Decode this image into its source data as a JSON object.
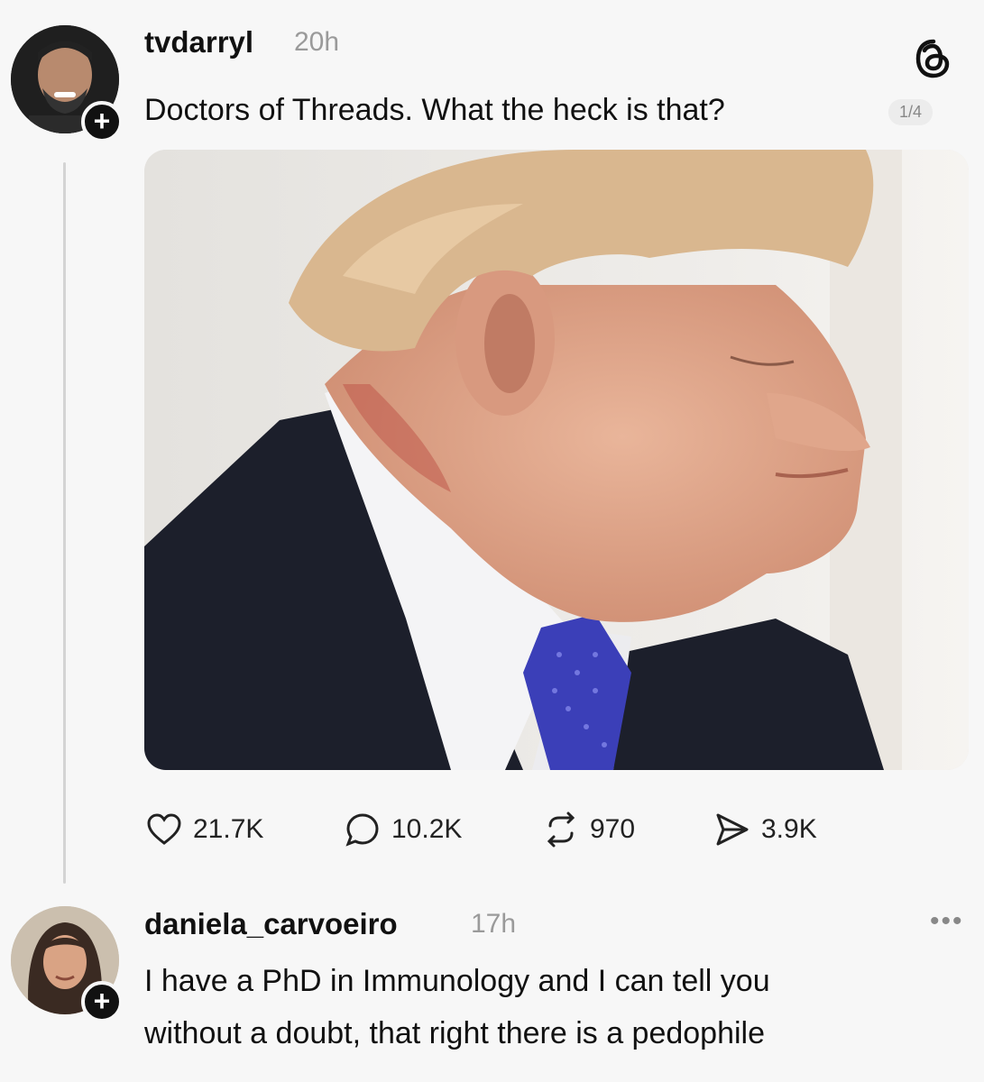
{
  "post": {
    "username": "tvdarryl",
    "time": "20h",
    "text": "Doctors of Threads. What the heck is that?",
    "image_counter": "1/4",
    "image_icon": "photo-man-profile-neck",
    "actions": {
      "likes": "21.7K",
      "replies": "10.2K",
      "reposts": "970",
      "shares": "3.9K"
    }
  },
  "reply": {
    "username": "daniela_carvoeiro",
    "time": "17h",
    "text_line1": "I have a PhD in Immunology and I can tell you",
    "text_line2": "without a doubt, that right there is a pedophile"
  },
  "icons": {
    "app_logo": "threads-logo-icon",
    "like": "heart-icon",
    "reply": "comment-icon",
    "repost": "repost-icon",
    "share": "send-icon",
    "more": "more-icon",
    "follow": "plus-icon"
  },
  "colors": {
    "background": "#f7f7f7",
    "muted": "#9a9a9a",
    "text": "#111111"
  }
}
